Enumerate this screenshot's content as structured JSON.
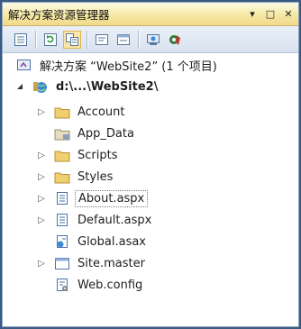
{
  "panel": {
    "title": "解决方案资源管理器",
    "buttons": {
      "dropdown": "▾",
      "pin": "□",
      "close": "✕"
    }
  },
  "toolbar": {
    "icons": [
      "properties-icon",
      "refresh-icon",
      "show-all-files-icon",
      "view-code-icon",
      "view-designer-icon",
      "copy-website-icon",
      "asp-net-config-icon"
    ]
  },
  "tree": {
    "solution": "解决方案 “WebSite2” (1 个项目)",
    "project": "d:\\...\\WebSite2\\",
    "items": [
      {
        "label": "Account",
        "icon": "folder-icon",
        "expander": "▷"
      },
      {
        "label": "App_Data",
        "icon": "app-data-folder-icon",
        "expander": ""
      },
      {
        "label": "Scripts",
        "icon": "folder-icon",
        "expander": "▷"
      },
      {
        "label": "Styles",
        "icon": "folder-icon",
        "expander": "▷"
      },
      {
        "label": "About.aspx",
        "icon": "aspx-page-icon",
        "expander": "▷",
        "selected": true
      },
      {
        "label": "Default.aspx",
        "icon": "aspx-page-icon",
        "expander": "▷"
      },
      {
        "label": "Global.asax",
        "icon": "global-asax-icon",
        "expander": ""
      },
      {
        "label": "Site.master",
        "icon": "master-page-icon",
        "expander": "▷"
      },
      {
        "label": "Web.config",
        "icon": "config-file-icon",
        "expander": ""
      }
    ]
  },
  "colors": {
    "title_bg": "#f6e9a8",
    "folder": "#e8c35a",
    "selection_border": "#7f7f7f"
  }
}
